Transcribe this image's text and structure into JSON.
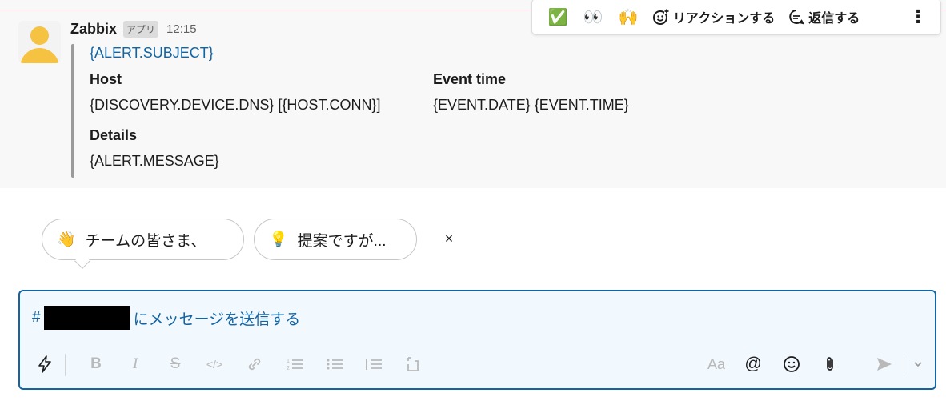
{
  "message": {
    "sender": "Zabbix",
    "badge": "アプリ",
    "time": "12:15",
    "subject": "{ALERT.SUBJECT}",
    "fields": {
      "host_label": "Host",
      "host_value": "{DISCOVERY.DEVICE.DNS} [{HOST.CONN}]",
      "event_time_label": "Event time",
      "event_time_value": "{EVENT.DATE} {EVENT.TIME}",
      "details_label": "Details",
      "details_value": "{ALERT.MESSAGE}"
    }
  },
  "hover_toolbar": {
    "emoji1": "✅",
    "emoji2": "👀",
    "emoji3": "🙌",
    "react_label": "リアクションする",
    "reply_label": "返信する",
    "more": "⋮"
  },
  "suggestions": [
    {
      "emoji": "👋",
      "text": "チームの皆さま、"
    },
    {
      "emoji": "💡",
      "text": "提案ですが..."
    }
  ],
  "suggestions_close": "×",
  "composer": {
    "hash": "#",
    "placeholder_suffix": "にメッセージを送信する"
  },
  "formatting": {
    "shortcuts": "ϟ",
    "bold": "B",
    "italic": "I",
    "strike": "S",
    "code": "</>",
    "aa": "Aa",
    "at": "@"
  },
  "colors": {
    "link_blue": "#1264a3",
    "unread_line": "#e8a3b4",
    "avatar_yellow": "#f5c242"
  }
}
